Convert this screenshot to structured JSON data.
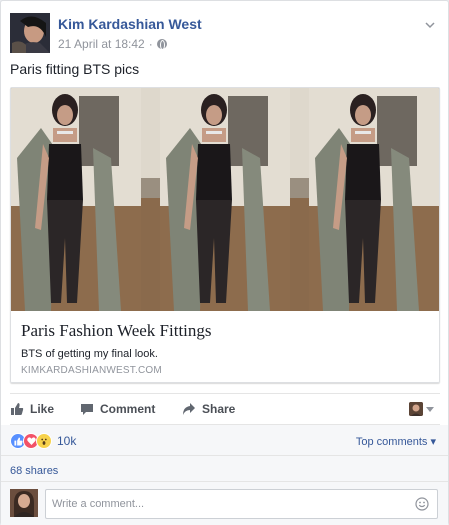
{
  "post": {
    "author": "Kim Kardashian West",
    "timestamp": "21 April at 18:42",
    "separator": "·",
    "audience_icon": "globe-icon",
    "text": "Paris fitting BTS pics"
  },
  "link": {
    "title": "Paris Fashion Week Fittings",
    "description": "BTS of getting my final look.",
    "domain": "KIMKARDASHIANWEST.COM"
  },
  "actions": {
    "like": "Like",
    "comment": "Comment",
    "share": "Share"
  },
  "stats": {
    "reactions": [
      "like",
      "love",
      "wow"
    ],
    "reaction_count": "10k",
    "sort_label": "Top comments",
    "sort_caret": "▾",
    "shares": "68 shares"
  },
  "composer": {
    "placeholder": "Write a comment..."
  },
  "colors": {
    "link_blue": "#365899",
    "muted_gray": "#90949c",
    "like_blue": "#5890ff",
    "love_red": "#f25268",
    "wow_yellow": "#f7d24b"
  }
}
